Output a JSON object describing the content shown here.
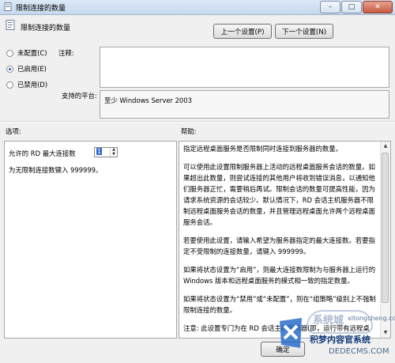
{
  "window": {
    "title": "限制连接的数量",
    "controls": {
      "minimize": "–",
      "maximize": "□",
      "close": "✕"
    }
  },
  "header": {
    "title": "限制连接的数量"
  },
  "nav": {
    "prev_label": "上一个设置(P)",
    "next_label": "下一个设置(N)"
  },
  "state": {
    "options": [
      {
        "label": "未配置(C)",
        "checked": false
      },
      {
        "label": "已启用(E)",
        "checked": true
      },
      {
        "label": "已禁用(D)",
        "checked": false
      }
    ]
  },
  "comment": {
    "label": "注释:",
    "value": ""
  },
  "platform": {
    "label": "支持的平台:",
    "value": "至少 Windows Server 2003"
  },
  "options_pane": {
    "heading": "选项:",
    "max_conn_label": "允许的 RD 最大连接数",
    "max_conn_value": "1",
    "hint": "为无限制连接数键入 999999。"
  },
  "help_pane": {
    "heading": "帮助:",
    "paragraphs": [
      "指定远程桌面服务是否限制同时连接到服务器的数量。",
      "可以使用此设置限制服务器上活动的远程桌面服务会话的数量。如果超出此数量，则尝试连接的其他用户将收到错误消息，以通知他们服务器正忙，需要稍后再试。限制会话的数量可提高性能，因为请求系统资源的会话较少。默认情况下，RD 会话主机服务器不限制远程桌面服务会话的数量，并且管理远程桌面允许两个远程桌面服务会话。",
      "若要使用此设置，请输入希望为服务器指定的最大连接数。若要指定不受限制的连接数量，请键入 999999。",
      "如果将状态设置为“启用”，则最大连接数限制为与服务器上运行的 Windows 版本和远程桌面服务的模式相一致的指定数量。",
      "如果将状态设置为“禁用”或“未配置”，则在“组策略”级别上不强制限制连接的数量。",
      "注意: 此设置专门为在 RD 会话主机服务器(即，运行带有远程桌"
    ]
  },
  "footer": {
    "ok_label": "确定"
  },
  "watermark": {
    "line1": "积梦内容官系统",
    "line2": "DEDECMS.COM",
    "arc": "系统城",
    "url": "xitongcheng.com"
  }
}
